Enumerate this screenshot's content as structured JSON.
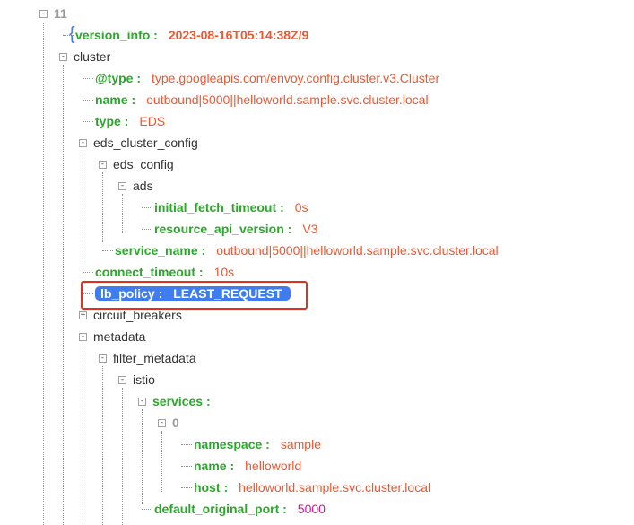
{
  "tree": {
    "nodes": [
      {
        "id": "n11",
        "kind": "index",
        "text": "11",
        "toggle": "-"
      },
      {
        "id": "version_info",
        "kind": "kv",
        "key": "version_info",
        "value": "2023-08-16T05:14:38Z/9",
        "value_bold": true
      },
      {
        "id": "cluster",
        "kind": "node",
        "text": "cluster",
        "toggle": "-"
      },
      {
        "id": "type_url",
        "kind": "kv",
        "key": "@type",
        "value": "type.googleapis.com/envoy.config.cluster.v3.Cluster"
      },
      {
        "id": "name",
        "kind": "kv",
        "key": "name",
        "value": "outbound|5000||helloworld.sample.svc.cluster.local"
      },
      {
        "id": "type",
        "kind": "kv",
        "key": "type",
        "value": "EDS"
      },
      {
        "id": "eds_cluster_config",
        "kind": "node",
        "text": "eds_cluster_config",
        "toggle": "-"
      },
      {
        "id": "eds_config",
        "kind": "node",
        "text": "eds_config",
        "toggle": "-"
      },
      {
        "id": "ads",
        "kind": "node",
        "text": "ads",
        "toggle": "-"
      },
      {
        "id": "initial_fetch_timeout",
        "kind": "kv",
        "key": "initial_fetch_timeout",
        "value": "0s"
      },
      {
        "id": "resource_api_version",
        "kind": "kv",
        "key": "resource_api_version",
        "value": "V3"
      },
      {
        "id": "service_name",
        "kind": "kv",
        "key": "service_name",
        "value": "outbound|5000||helloworld.sample.svc.cluster.local"
      },
      {
        "id": "connect_timeout",
        "kind": "kv",
        "key": "connect_timeout",
        "value": "10s"
      },
      {
        "id": "lb_policy",
        "kind": "kv",
        "key": "lb_policy",
        "value": "LEAST_REQUEST",
        "selected": true
      },
      {
        "id": "circuit_breakers",
        "kind": "node",
        "text": "circuit_breakers",
        "toggle": "+"
      },
      {
        "id": "metadata",
        "kind": "node",
        "text": "metadata",
        "toggle": "-"
      },
      {
        "id": "filter_metadata",
        "kind": "node",
        "text": "filter_metadata",
        "toggle": "-"
      },
      {
        "id": "istio",
        "kind": "node",
        "text": "istio",
        "toggle": "-"
      },
      {
        "id": "services",
        "kind": "kv",
        "key": "services",
        "value": "",
        "toggle": "-"
      },
      {
        "id": "svc0",
        "kind": "index",
        "text": "0",
        "toggle": "-"
      },
      {
        "id": "namespace",
        "kind": "kv",
        "key": "namespace",
        "value": "sample"
      },
      {
        "id": "svc_name",
        "kind": "kv",
        "key": "name",
        "value": "helloworld"
      },
      {
        "id": "host",
        "kind": "kv",
        "key": "host",
        "value": "helloworld.sample.svc.cluster.local"
      },
      {
        "id": "default_original_port",
        "kind": "kv",
        "key": "default_original_port",
        "value": "5000",
        "numeric": true
      }
    ]
  },
  "colors": {
    "key": "#2aa82a",
    "value": "#f0562f",
    "number": "#d6168c",
    "selection": "#3f7cf0",
    "highlight_box": "#e0301e"
  }
}
